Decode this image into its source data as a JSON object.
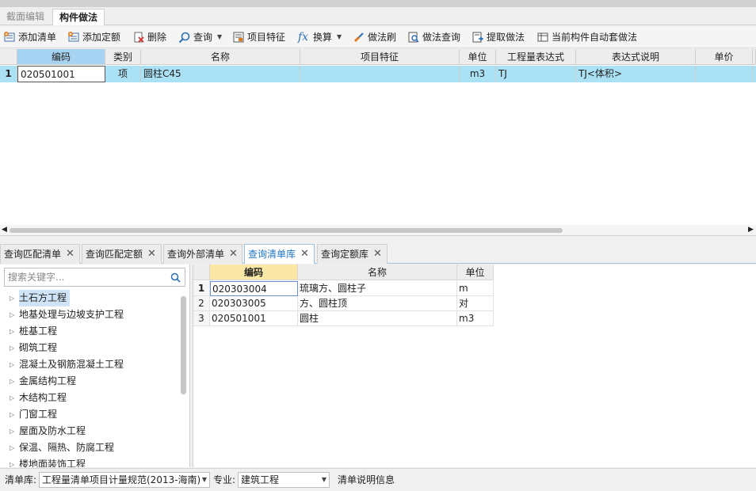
{
  "top_tabs": [
    {
      "label": "截面编辑"
    },
    {
      "label": "构件做法"
    }
  ],
  "toolbar": {
    "add_list": "添加清单",
    "add_quota": "添加定额",
    "delete": "删除",
    "query": "查询",
    "item_feature": "项目特征",
    "convert": "换算",
    "method_brush": "做法刷",
    "method_query": "做法查询",
    "extract_method": "提取做法",
    "auto_method": "当前构件自动套做法"
  },
  "top_grid": {
    "columns": [
      "编码",
      "类别",
      "名称",
      "项目特征",
      "单位",
      "工程量表达式",
      "表达式说明",
      "单价"
    ],
    "rows": [
      {
        "num": "1",
        "code": "020501001",
        "type": "项",
        "name": "圆柱C45",
        "feature": "",
        "unit": "m3",
        "expr": "TJ",
        "expr_desc": "TJ<体积>",
        "price": ""
      }
    ]
  },
  "bottom_tabs": [
    {
      "label": "查询匹配清单"
    },
    {
      "label": "查询匹配定额"
    },
    {
      "label": "查询外部清单"
    },
    {
      "label": "查询清单库"
    },
    {
      "label": "查询定额库"
    }
  ],
  "search": {
    "placeholder": "搜索关键字..."
  },
  "tree": [
    "土石方工程",
    "地基处理与边坡支护工程",
    "桩基工程",
    "砌筑工程",
    "混凝土及钢筋混凝土工程",
    "金属结构工程",
    "木结构工程",
    "门窗工程",
    "屋面及防水工程",
    "保温、隔热、防腐工程",
    "楼地面装饰工程"
  ],
  "result_grid": {
    "columns": [
      "编码",
      "名称",
      "单位"
    ],
    "rows": [
      {
        "num": "1",
        "code": "020303004",
        "name": "琉璃方、圆柱子",
        "unit": "m"
      },
      {
        "num": "2",
        "code": "020303005",
        "name": "方、圆柱顶",
        "unit": "对"
      },
      {
        "num": "3",
        "code": "020501001",
        "name": "圆柱",
        "unit": "m3"
      }
    ]
  },
  "statusbar": {
    "list_label": "清单库:",
    "list_value": "工程量清单项目计量规范(2013-海南)",
    "major_label": "专业:",
    "major_value": "建筑工程",
    "info": "清单说明信息"
  },
  "colors": {
    "selected_row": "#abe1f5",
    "header_selected": "#a7d3f2",
    "active_tab_text": "#1f76c4",
    "result_header_selected": "#fbe8a6"
  }
}
